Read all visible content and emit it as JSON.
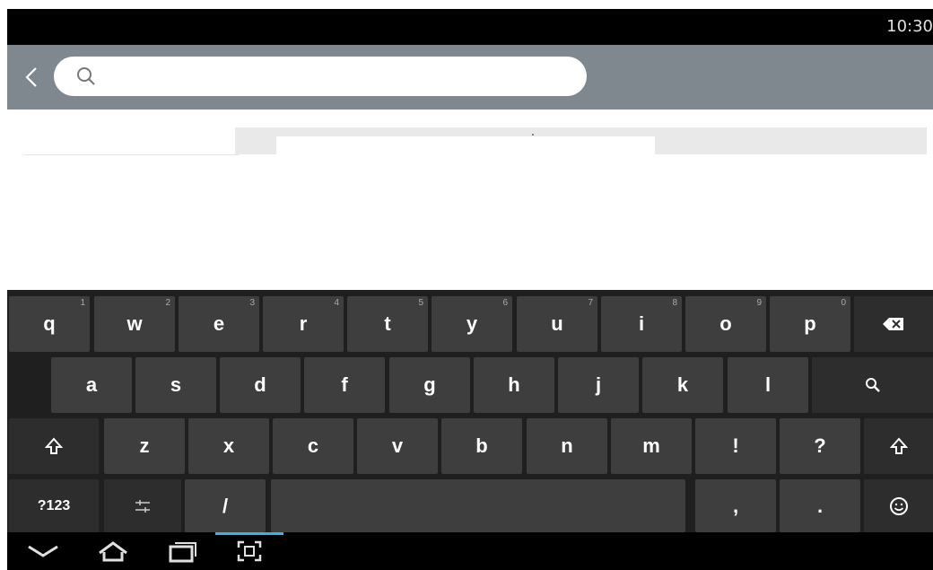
{
  "status_bar": {
    "time": "10:30"
  },
  "search": {
    "placeholder": "",
    "value": ""
  },
  "keyboard": {
    "row1": [
      {
        "label": "q",
        "hint": "1"
      },
      {
        "label": "w",
        "hint": "2"
      },
      {
        "label": "e",
        "hint": "3"
      },
      {
        "label": "r",
        "hint": "4"
      },
      {
        "label": "t",
        "hint": "5"
      },
      {
        "label": "y",
        "hint": "6"
      },
      {
        "label": "u",
        "hint": "7"
      },
      {
        "label": "i",
        "hint": "8"
      },
      {
        "label": "o",
        "hint": "9"
      },
      {
        "label": "p",
        "hint": "0"
      }
    ],
    "row2": [
      "a",
      "s",
      "d",
      "f",
      "g",
      "h",
      "j",
      "k",
      "l"
    ],
    "row3": [
      "z",
      "x",
      "c",
      "v",
      "b",
      "n",
      "m",
      "!",
      "?"
    ],
    "symbols_label": "?123",
    "slash_label": "/",
    "comma_label": ",",
    "period_label": "."
  },
  "icons": {
    "back": "chevron-left-icon",
    "search": "search-icon",
    "backspace": "backspace-icon",
    "enter_search": "search-icon",
    "shift": "shift-icon",
    "settings": "settings-sliders-icon",
    "emoji": "emoji-icon",
    "nav_back": "nav-back-icon",
    "nav_home": "nav-home-icon",
    "nav_recents": "nav-recents-icon",
    "nav_screenshot": "screenshot-icon"
  }
}
